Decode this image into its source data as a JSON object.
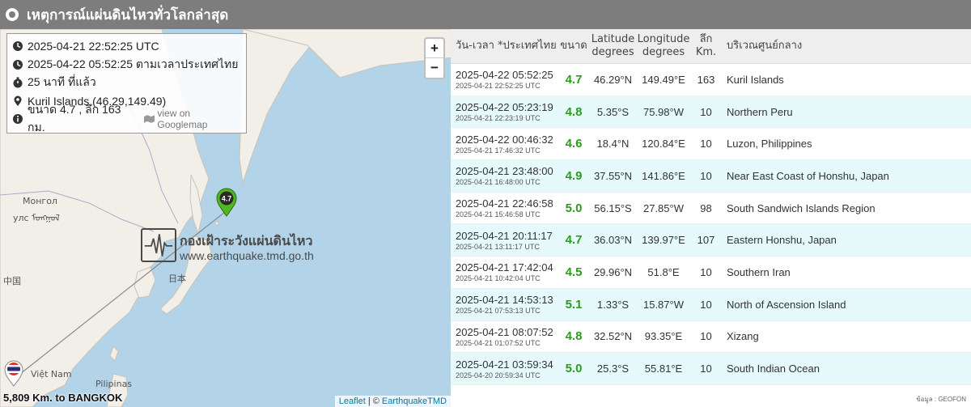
{
  "header": {
    "title": "เหตุการณ์แผ่นดินไหวทั่วโลกล่าสุด"
  },
  "map": {
    "zoom_in": "+",
    "zoom_out": "−",
    "info": {
      "utc": "2025-04-21 22:52:25 UTC",
      "thai": "2025-04-22 05:52:25 ตามเวลาประเทศไทย",
      "ago": "25 นาที ที่แล้ว",
      "location": "Kuril Islands (46.29,149.49)",
      "detail": "ขนาด 4.7 , ลึก 163 กม.",
      "map_link": "view on Googlemap"
    },
    "marker_label": "4.7",
    "watermark_title": "กองเฝ้าระวังแผ่นดินไหว",
    "watermark_url": "www.earthquake.tmd.go.th",
    "labels": {
      "mongolia": "Монгол",
      "mongolia2": "улс ᠮᠣᠩᠭᠣᠯ",
      "china": "中国",
      "japan": "日本",
      "vietnam": "Việt Nam",
      "philippines": "Pilipinas"
    },
    "distance": "5,809 Km. to BANGKOK",
    "attribution_leaflet": "Leaflet",
    "attribution_sep": " | © ",
    "attribution_tmd": "EarthquakeTMD"
  },
  "table": {
    "headers": {
      "time": "วัน-เวลา *ประเทศไทย",
      "mag": "ขนาด",
      "lat": "Latitude degrees",
      "lon": "Longitude degrees",
      "depth": "ลึก Km.",
      "region": "บริเวณศูนย์กลาง"
    },
    "rows": [
      {
        "thai": "2025-04-22 05:52:25",
        "utc": "2025-04-21 22:52:25 UTC",
        "mag": "4.7",
        "lat": "46.29°N",
        "lon": "149.49°E",
        "depth": "163",
        "region": "Kuril Islands"
      },
      {
        "thai": "2025-04-22 05:23:19",
        "utc": "2025-04-21 22:23:19 UTC",
        "mag": "4.8",
        "lat": "5.35°S",
        "lon": "75.98°W",
        "depth": "10",
        "region": "Northern Peru"
      },
      {
        "thai": "2025-04-22 00:46:32",
        "utc": "2025-04-21 17:46:32 UTC",
        "mag": "4.6",
        "lat": "18.4°N",
        "lon": "120.84°E",
        "depth": "10",
        "region": "Luzon, Philippines"
      },
      {
        "thai": "2025-04-21 23:48:00",
        "utc": "2025-04-21 16:48:00 UTC",
        "mag": "4.9",
        "lat": "37.55°N",
        "lon": "141.86°E",
        "depth": "10",
        "region": "Near East Coast of Honshu, Japan"
      },
      {
        "thai": "2025-04-21 22:46:58",
        "utc": "2025-04-21 15:46:58 UTC",
        "mag": "5.0",
        "lat": "56.15°S",
        "lon": "27.85°W",
        "depth": "98",
        "region": "South Sandwich Islands Region"
      },
      {
        "thai": "2025-04-21 20:11:17",
        "utc": "2025-04-21 13:11:17 UTC",
        "mag": "4.7",
        "lat": "36.03°N",
        "lon": "139.97°E",
        "depth": "107",
        "region": "Eastern Honshu, Japan"
      },
      {
        "thai": "2025-04-21 17:42:04",
        "utc": "2025-04-21 10:42:04 UTC",
        "mag": "4.5",
        "lat": "29.96°N",
        "lon": "51.8°E",
        "depth": "10",
        "region": "Southern Iran"
      },
      {
        "thai": "2025-04-21 14:53:13",
        "utc": "2025-04-21 07:53:13 UTC",
        "mag": "5.1",
        "lat": "1.33°S",
        "lon": "15.87°W",
        "depth": "10",
        "region": "North of Ascension Island"
      },
      {
        "thai": "2025-04-21 08:07:52",
        "utc": "2025-04-21 01:07:52 UTC",
        "mag": "4.8",
        "lat": "32.52°N",
        "lon": "93.35°E",
        "depth": "10",
        "region": "Xizang"
      },
      {
        "thai": "2025-04-21 03:59:34",
        "utc": "2025-04-20 20:59:34 UTC",
        "mag": "5.0",
        "lat": "25.3°S",
        "lon": "55.81°E",
        "depth": "10",
        "region": "South Indian Ocean"
      }
    ],
    "source": "ข้อมูล : GEOFON"
  },
  "colors": {
    "header_bg": "#7d7d7d",
    "magnitude": "#2e9a1f",
    "row_alt": "#e6fafb",
    "sea": "#b3d3e8",
    "land": "#f2efe9"
  }
}
